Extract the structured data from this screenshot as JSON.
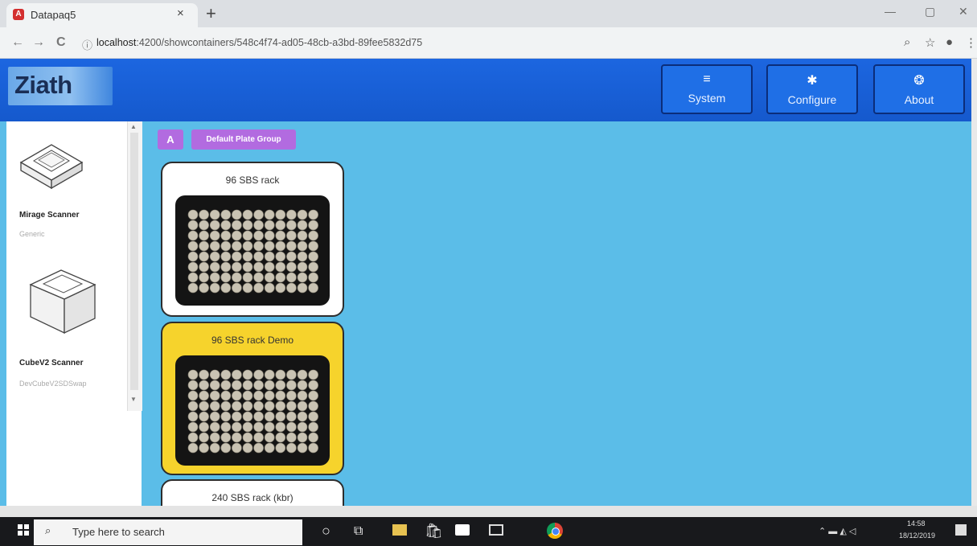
{
  "browser": {
    "tab_title": "Datapaq5",
    "tab_close": "×",
    "new_tab": "+",
    "favicon_letter": "A",
    "url_host": "localhost",
    "url_rest": ":4200/showcontainers/548c4f74-ad05-48cb-a3bd-89fee5832d75",
    "back": "←",
    "forward": "→",
    "reload": "C",
    "info": "ⓘ",
    "zoom": "⌕",
    "star": "☆",
    "account": "●",
    "menu": "⋮",
    "win_min": "—",
    "win_max": "▢",
    "win_close": "✕"
  },
  "header": {
    "logo": "Ziath",
    "buttons": [
      {
        "label": "System",
        "icon": "≡"
      },
      {
        "label": "Configure",
        "icon": "✱"
      },
      {
        "label": "About",
        "icon": "❂"
      }
    ]
  },
  "sidebar": {
    "scanners": [
      {
        "name": "Mirage Scanner",
        "subtitle": "Generic"
      },
      {
        "name": "CubeV2 Scanner",
        "subtitle": "DevCubeV2SDSwap"
      }
    ],
    "scroll_up": "▲",
    "scroll_down": "▼"
  },
  "group": {
    "letter": "A",
    "label": "Default Plate Group"
  },
  "racks": [
    {
      "title": "96 SBS rack",
      "selected": false
    },
    {
      "title": "96 SBS rack Demo",
      "selected": true
    },
    {
      "title": "240 SBS rack (kbr)",
      "selected": false
    }
  ],
  "taskbar": {
    "search_placeholder": "Type here to search",
    "time": "14:58",
    "date": "18/12/2019"
  },
  "colors": {
    "header_blue": "#1559cd",
    "main_bg": "#5bbde8",
    "group_purple": "#b26be0",
    "selected_yellow": "#f6d32c"
  }
}
